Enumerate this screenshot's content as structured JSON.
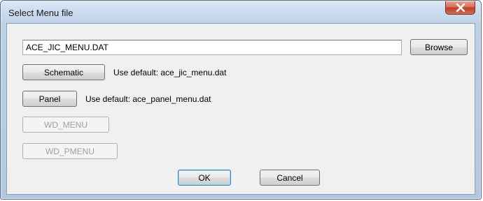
{
  "window": {
    "title": "Select Menu file",
    "close_label": "Close"
  },
  "file_field": {
    "value": "ACE_JIC_MENU.DAT"
  },
  "buttons": {
    "browse": "Browse",
    "schematic": "Schematic",
    "panel": "Panel",
    "wd_menu": "WD_MENU",
    "wd_pmenu": "WD_PMENU",
    "ok": "OK",
    "cancel": "Cancel"
  },
  "labels": {
    "schematic_default": "Use default: ace_jic_menu.dat",
    "panel_default": "Use default: ace_panel_menu.dat"
  },
  "icons": {
    "close": "close-x-icon"
  },
  "colors": {
    "close_button": "#c7432f",
    "client_bg": "#f0f0f0",
    "frame": "#bcd0e6"
  }
}
